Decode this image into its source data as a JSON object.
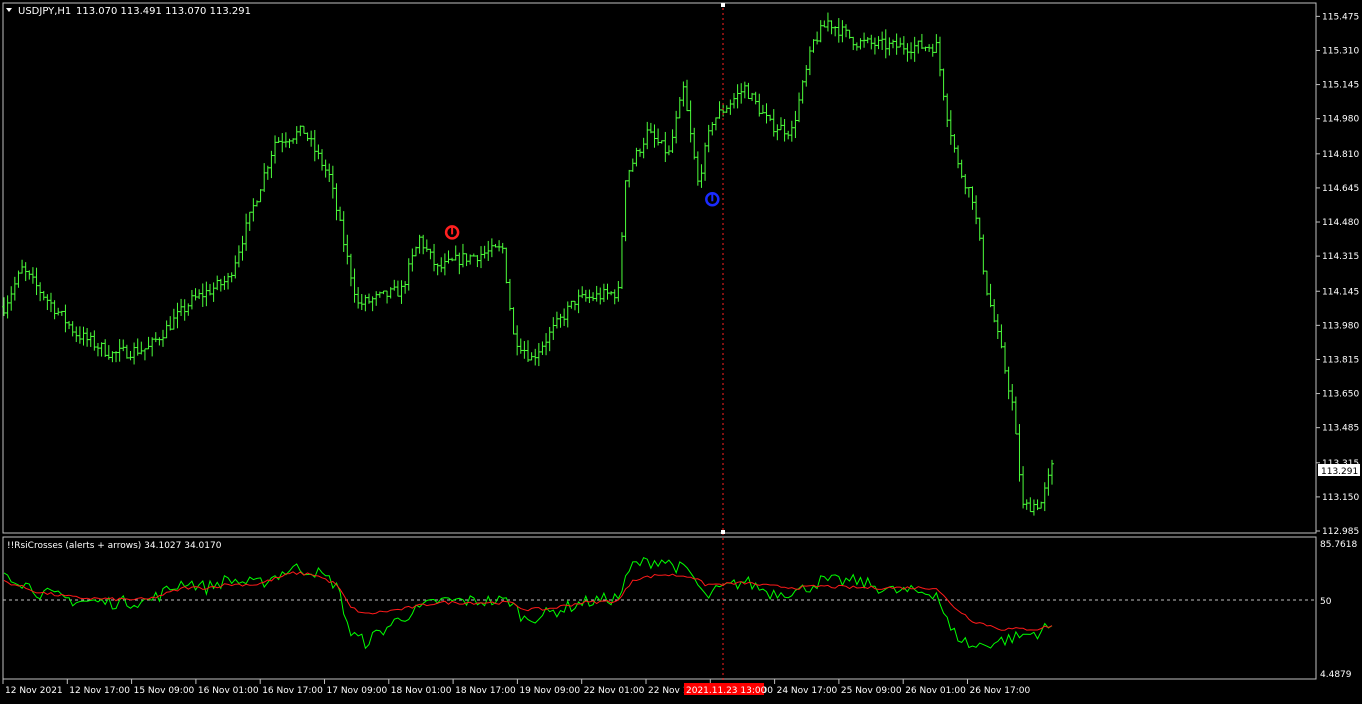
{
  "colors": {
    "background": "#000000",
    "frame": "#c0c0c0",
    "text": "#ffffff",
    "bar": "#4cff3b",
    "rsi": "#00ff00",
    "signal": "#ff1a1a",
    "crosshair": "#ff2020",
    "up_arrow": "#ff2020",
    "down_arrow": "#1a2bff",
    "price_tag_bg": "#ffffff",
    "price_tag_text": "#000000",
    "time_tag_bg": "#ff0000"
  },
  "main_panel": {
    "symbol_label": "USDJPY,H1",
    "ohlc_label": "113.070 113.491 113.070 113.291",
    "current_price": "113.291",
    "price_scale": [
      "115.475",
      "115.310",
      "115.145",
      "114.980",
      "114.810",
      "114.645",
      "114.480",
      "114.315",
      "114.145",
      "113.980",
      "113.815",
      "113.650",
      "113.485",
      "113.315",
      "113.150",
      "112.985"
    ]
  },
  "sub_panel": {
    "indicator_label": "!!RsiCrosses (alerts + arrows) 34.1027 34.0170",
    "scale_top": "85.7618",
    "scale_mid": "50",
    "scale_bottom": "4.4879"
  },
  "time_axis": {
    "labels": [
      "12 Nov 2021",
      "12 Nov 17:00",
      "15 Nov 09:00",
      "16 Nov 01:00",
      "16 Nov 17:00",
      "17 Nov 09:00",
      "18 Nov 01:00",
      "18 Nov 17:00",
      "19 Nov 09:00",
      "22 Nov 01:00",
      "22 Nov 17:00",
      "24 Nov 01:00",
      "24 Nov 17:00",
      "25 Nov 09:00",
      "26 Nov 01:00",
      "26 Nov 17:00"
    ],
    "crosshair_time": "2021.11.23 13:00"
  },
  "chart_data": [
    {
      "type": "ohlc",
      "title": "USDJPY,H1",
      "ylim": [
        112.985,
        115.53
      ],
      "anchors": [
        {
          "x": 0,
          "y": 114.07
        },
        {
          "x": 5,
          "y": 114.25
        },
        {
          "x": 20,
          "y": 113.94
        },
        {
          "x": 30,
          "y": 113.84
        },
        {
          "x": 40,
          "y": 113.87
        },
        {
          "x": 52,
          "y": 114.1
        },
        {
          "x": 62,
          "y": 114.2
        },
        {
          "x": 68,
          "y": 114.5
        },
        {
          "x": 75,
          "y": 114.87
        },
        {
          "x": 83,
          "y": 114.92
        },
        {
          "x": 90,
          "y": 114.7
        },
        {
          "x": 95,
          "y": 114.3
        },
        {
          "x": 98,
          "y": 114.08
        },
        {
          "x": 110,
          "y": 114.15
        },
        {
          "x": 115,
          "y": 114.4
        },
        {
          "x": 120,
          "y": 114.25
        },
        {
          "x": 126,
          "y": 114.3
        },
        {
          "x": 138,
          "y": 114.35
        },
        {
          "x": 141,
          "y": 113.93
        },
        {
          "x": 146,
          "y": 113.82
        },
        {
          "x": 158,
          "y": 114.1
        },
        {
          "x": 170,
          "y": 114.14
        },
        {
          "x": 172,
          "y": 114.7
        },
        {
          "x": 178,
          "y": 114.91
        },
        {
          "x": 184,
          "y": 114.81
        },
        {
          "x": 188,
          "y": 115.12
        },
        {
          "x": 192,
          "y": 114.67
        },
        {
          "x": 196,
          "y": 114.97
        },
        {
          "x": 205,
          "y": 115.13
        },
        {
          "x": 212,
          "y": 114.95
        },
        {
          "x": 218,
          "y": 114.92
        },
        {
          "x": 224,
          "y": 115.35
        },
        {
          "x": 228,
          "y": 115.45
        },
        {
          "x": 236,
          "y": 115.35
        },
        {
          "x": 246,
          "y": 115.33
        },
        {
          "x": 258,
          "y": 115.33
        },
        {
          "x": 261,
          "y": 115.0
        },
        {
          "x": 264,
          "y": 114.75
        },
        {
          "x": 268,
          "y": 114.6
        },
        {
          "x": 272,
          "y": 114.15
        },
        {
          "x": 276,
          "y": 113.85
        },
        {
          "x": 279,
          "y": 113.6
        },
        {
          "x": 282,
          "y": 113.1
        },
        {
          "x": 287,
          "y": 113.12
        },
        {
          "x": 290,
          "y": 113.29
        }
      ],
      "markers": [
        {
          "type": "cross_up",
          "x": 124,
          "y": 114.43
        },
        {
          "type": "cross_down",
          "x": 196,
          "y": 114.59
        }
      ]
    },
    {
      "type": "line",
      "title": "!!RsiCrosses (alerts + arrows)",
      "ylim": [
        4.4879,
        85.7618
      ],
      "reference_line": 50,
      "series": [
        {
          "name": "rsi",
          "values": [
            [
              0,
              68
            ],
            [
              10,
              55
            ],
            [
              20,
              50
            ],
            [
              30,
              49
            ],
            [
              40,
              50
            ],
            [
              50,
              62
            ],
            [
              56,
              58
            ],
            [
              62,
              63
            ],
            [
              70,
              60
            ],
            [
              80,
              70
            ],
            [
              86,
              68
            ],
            [
              92,
              60
            ],
            [
              96,
              30
            ],
            [
              100,
              25
            ],
            [
              110,
              40
            ],
            [
              120,
              50
            ],
            [
              130,
              50
            ],
            [
              140,
              50
            ],
            [
              144,
              39
            ],
            [
              150,
              42
            ],
            [
              160,
              49
            ],
            [
              170,
              52
            ],
            [
              174,
              72
            ],
            [
              182,
              75
            ],
            [
              190,
              67
            ],
            [
              194,
              52
            ],
            [
              198,
              57
            ],
            [
              205,
              62
            ],
            [
              212,
              55
            ],
            [
              220,
              56
            ],
            [
              226,
              62
            ],
            [
              236,
              62
            ],
            [
              246,
              56
            ],
            [
              258,
              55
            ],
            [
              262,
              32
            ],
            [
              268,
              22
            ],
            [
              276,
              26
            ],
            [
              286,
              31
            ],
            [
              290,
              35
            ]
          ]
        },
        {
          "name": "signal",
          "values": [
            [
              0,
              62
            ],
            [
              10,
              55
            ],
            [
              20,
              52
            ],
            [
              30,
              51
            ],
            [
              40,
              51
            ],
            [
              50,
              58
            ],
            [
              56,
              58
            ],
            [
              62,
              60
            ],
            [
              70,
              60
            ],
            [
              80,
              67
            ],
            [
              86,
              66
            ],
            [
              92,
              60
            ],
            [
              96,
              46
            ],
            [
              100,
              42
            ],
            [
              110,
              45
            ],
            [
              120,
              49
            ],
            [
              130,
              49
            ],
            [
              140,
              49
            ],
            [
              144,
              45
            ],
            [
              150,
              45
            ],
            [
              160,
              49
            ],
            [
              170,
              50
            ],
            [
              174,
              63
            ],
            [
              182,
              66
            ],
            [
              190,
              65
            ],
            [
              194,
              60
            ],
            [
              198,
              60
            ],
            [
              205,
              61
            ],
            [
              212,
              59
            ],
            [
              220,
              58
            ],
            [
              226,
              59
            ],
            [
              236,
              58
            ],
            [
              246,
              58
            ],
            [
              258,
              58
            ],
            [
              262,
              48
            ],
            [
              268,
              38
            ],
            [
              276,
              33
            ],
            [
              286,
              33
            ],
            [
              290,
              35
            ]
          ]
        }
      ]
    }
  ]
}
